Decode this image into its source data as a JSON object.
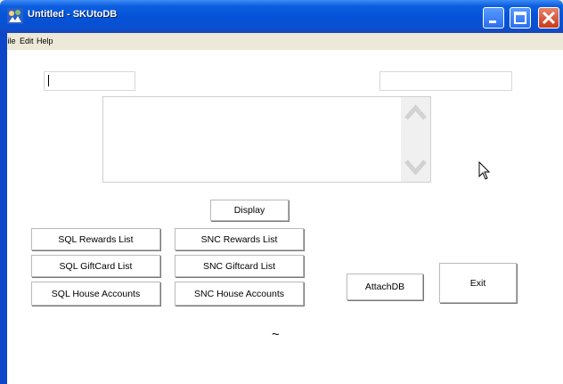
{
  "window": {
    "title": "Untitled - SKUtoDB"
  },
  "menu": [
    "File",
    "Edit",
    "Help"
  ],
  "inputs": {
    "left_value": "",
    "right_value": ""
  },
  "buttons": {
    "display": "Display",
    "sql_rewards": "SQL Rewards List",
    "snc_rewards": "SNC Rewards List",
    "sql_giftcard": "SQL GiftCard List",
    "snc_giftcard": "SNC Giftcard List",
    "sql_house": "SQL House Accounts",
    "snc_house": "SNC House Accounts",
    "attachdb": "AttachDB",
    "exit": "Exit"
  },
  "misc": {
    "tilde": "~"
  },
  "icons": {
    "app": "app-icon",
    "minimize": "minimize-icon",
    "maximize": "maximize-icon",
    "close": "close-icon",
    "scroll_up": "chevron-up-icon",
    "scroll_down": "chevron-down-icon",
    "cursor": "mouse-cursor-icon"
  },
  "colors": {
    "titlebar": "#0553d8",
    "close_button": "#c8391c",
    "window_bg": "#ece9d8"
  }
}
